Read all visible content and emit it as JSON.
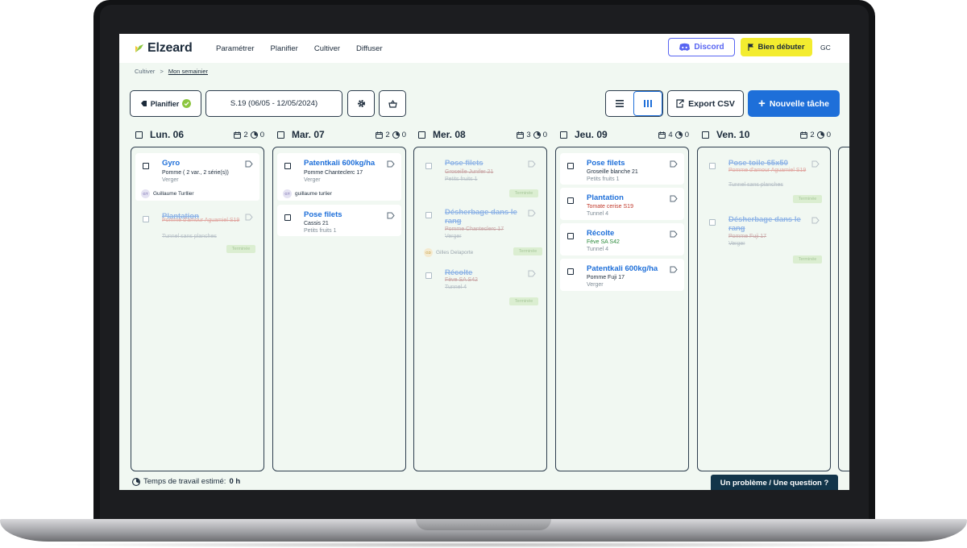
{
  "app": {
    "logo_text": "Elzeard"
  },
  "nav": {
    "items": [
      "Paramétrer",
      "Planifier",
      "Cultiver",
      "Diffuser"
    ]
  },
  "header": {
    "discord_label": "Discord",
    "start_label": "Bien débuter",
    "user_initials": "GC"
  },
  "breadcrumb": {
    "parent": "Cultiver",
    "separator": ">",
    "current": "Mon semainier"
  },
  "toolbar": {
    "plan_label": "Planifier",
    "week_label": "S.19 (06/05 - 12/05/2024)",
    "export_label": "Export CSV",
    "new_task_label": "Nouvelle tâche"
  },
  "days": [
    {
      "name": "Lun. 06",
      "tasks": "2",
      "time": "0"
    },
    {
      "name": "Mar. 07",
      "tasks": "2",
      "time": "0"
    },
    {
      "name": "Mer. 08",
      "tasks": "3",
      "time": "0"
    },
    {
      "name": "Jeu. 09",
      "tasks": "4",
      "time": "0"
    },
    {
      "name": "Ven. 10",
      "tasks": "2",
      "time": "0"
    }
  ],
  "cards": {
    "mon": [
      {
        "title": "Gyro",
        "line1": "Pomme ( 2 var., 2 série(s))",
        "line2": "Verger",
        "assignee_initials": "GT",
        "assignee": "Guillaume Turllier"
      },
      {
        "title": "Plantation",
        "line1": "Pomme d'amour Aguamiel S19",
        "line2": "Tunnel sans planches",
        "status": "Terminée"
      }
    ],
    "tue": [
      {
        "title": "Patentkali 600kg/ha",
        "line1": "Pomme Chanteclerc 17",
        "line2": "Verger",
        "assignee_initials": "GT",
        "assignee": "guillaume turlier"
      },
      {
        "title": "Pose filets",
        "line1": "Cassis 21",
        "line2": "Petits fruits 1"
      }
    ],
    "wed": [
      {
        "title": "Pose filets",
        "line1": "Groseille Junifer 21",
        "line2": "Petits fruits 1",
        "status": "Terminée"
      },
      {
        "title": "Désherbage dans le rang",
        "line1": "Pomme Chanteclerc 17",
        "line2": "Verger",
        "assignee_initials": "GD",
        "assignee": "Gilles Delaporte",
        "status": "Terminée"
      },
      {
        "title": "Récolte",
        "line1": "Fève SA S42",
        "line2": "Tunnel 4",
        "status": "Terminée"
      }
    ],
    "thu": [
      {
        "title": "Pose filets",
        "line1": "Groseille blanche 21",
        "line2": "Petits fruits 1"
      },
      {
        "title": "Plantation",
        "line1": "Tomate cerise S19",
        "line2": "Tunnel 4"
      },
      {
        "title": "Récolte",
        "line1": "Fève SA S42",
        "line2": "Tunnel 4"
      },
      {
        "title": "Patentkali 600kg/ha",
        "line1": "Pomme Fuji 17",
        "line2": "Verger"
      }
    ],
    "fri": [
      {
        "title": "Pose toile 65x50",
        "line1": "Pomme d'amour Aguamiel S19",
        "line2": "Tunnel sans planches",
        "status": "Terminée"
      },
      {
        "title": "Désherbage dans le rang",
        "line1": "Pomme Fuji 17",
        "line2": "Verger",
        "status": "Terminée"
      }
    ]
  },
  "footer": {
    "estimate_label": "Temps de travail estimé:",
    "estimate_value": "0 h",
    "help_label": "Un problème / Une question ?"
  },
  "colors": {
    "primary": "#1e6fd9",
    "discord": "#5865f2",
    "start": "#f3ec2f",
    "help": "#12354a",
    "background": "#f1f8f2"
  }
}
